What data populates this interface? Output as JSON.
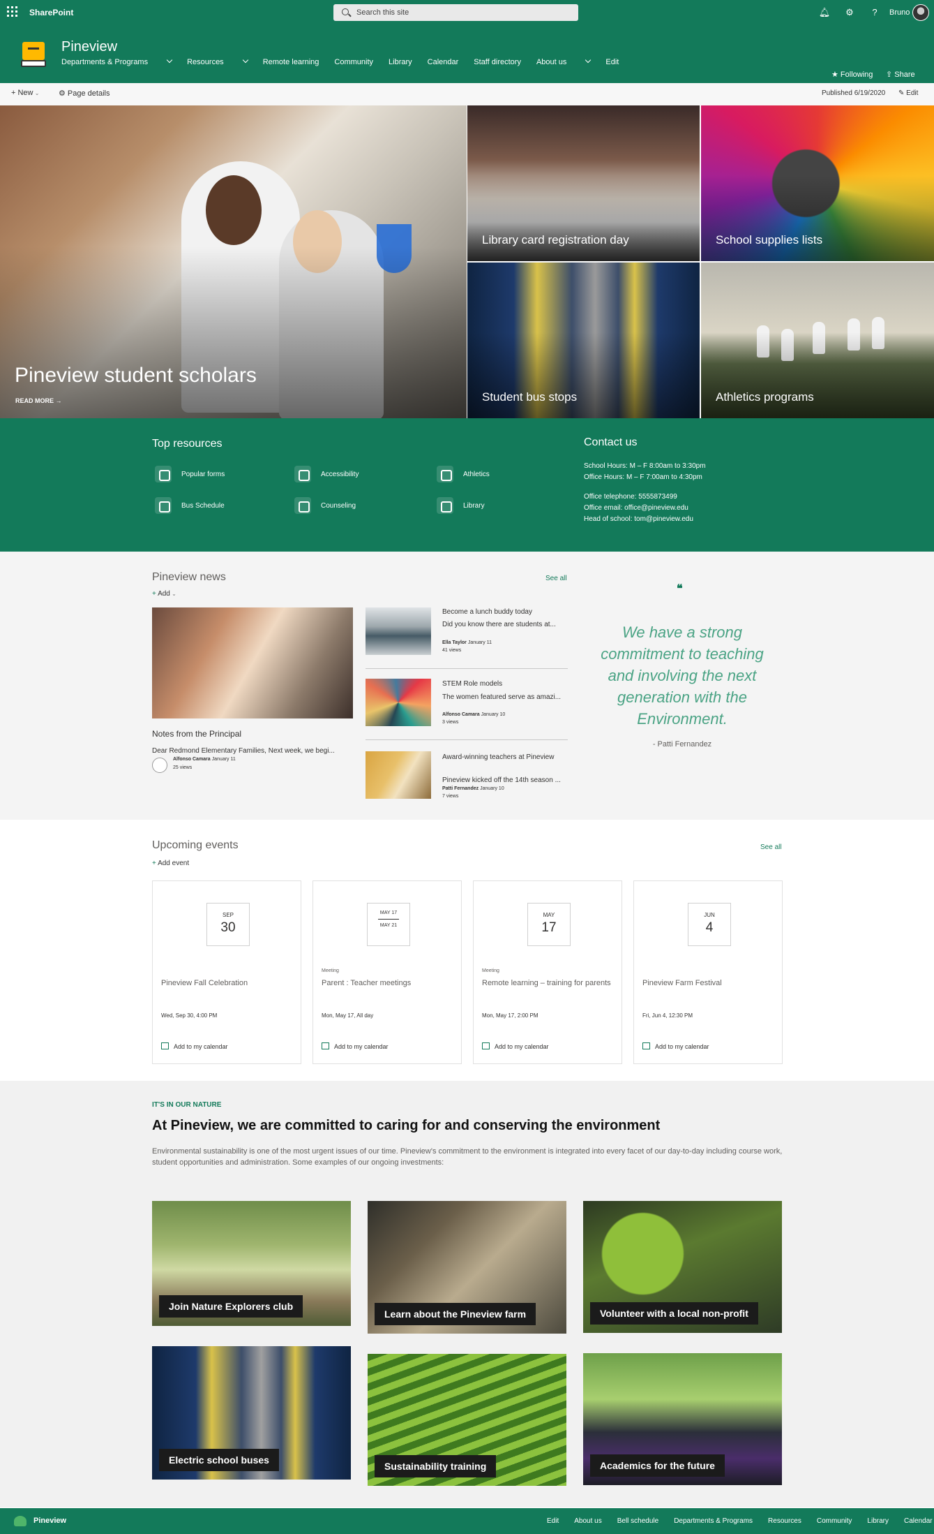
{
  "suite": {
    "brand": "SharePoint",
    "search_placeholder": "Search this site",
    "user": "Bruno",
    "icons": [
      "bell-icon",
      "gear-icon",
      "help-icon"
    ]
  },
  "site": {
    "name": "Pineview",
    "nav": [
      "Departments & Programs",
      "Resources",
      "Remote learning",
      "Community",
      "Library",
      "Calendar",
      "Staff directory",
      "About us",
      "Edit"
    ],
    "following": "Following",
    "share": "Share"
  },
  "command": {
    "new": "New",
    "page_details": "Page details",
    "published": "Published 6/19/2020",
    "edit": "Edit"
  },
  "hero": {
    "main_title": "Pineview student scholars",
    "read_more": "READ MORE",
    "tiles": [
      "Library card registration day",
      "School supplies lists",
      "Student bus stops",
      "Athletics programs"
    ]
  },
  "resources": {
    "title": "Top resources",
    "items": [
      "Popular forms",
      "Accessibility",
      "Athletics",
      "Bus Schedule",
      "Counseling",
      "Library"
    ]
  },
  "contact": {
    "title": "Contact us",
    "lines": [
      "School Hours: M – F 8:00am to 3:30pm",
      "Office Hours: M – F 7:00am to 4:30pm",
      "Office telephone: 5555873499",
      "Office email: office@pineview.edu",
      "Head of school: tom@pineview.edu"
    ]
  },
  "news": {
    "title": "Pineview news",
    "see_all": "See all",
    "add": "Add",
    "main": {
      "title": "Notes from the Principal",
      "desc": "Dear Redmond Elementary Families, Next week, we begi...",
      "author": "Alfonso Camara",
      "date": "January 11",
      "views": "25 views"
    },
    "items": [
      {
        "title": "Become a lunch buddy today",
        "desc": "Did you know there are students at...",
        "author": "Ella Taylor",
        "date": "January 11",
        "views": "41 views"
      },
      {
        "title": "STEM Role models",
        "desc": "The women featured serve as amazi...",
        "author": "Alfonso Camara",
        "date": "January 10",
        "views": "3 views"
      },
      {
        "title": "Award-winning teachers at Pineview",
        "desc": "Pineview kicked off the 14th season ...",
        "author": "Patti Fernandez",
        "date": "January 10",
        "views": "7 views"
      }
    ],
    "quote_mark": "❝",
    "quote": "We have a strong commitment to teaching and involving the next generation with the Environment.",
    "quote_author": "- Patti Fernandez"
  },
  "events": {
    "title": "Upcoming events",
    "see_all": "See all",
    "add": "Add event",
    "add_to_cal": "Add to my calendar",
    "items": [
      {
        "month": "SEP",
        "day": "30",
        "category": "",
        "name": "Pineview Fall Celebration",
        "time": "Wed, Sep 30, 4:00 PM"
      },
      {
        "range_start": "MAY 17",
        "range_end": "MAY 21",
        "category": "Meeting",
        "name": "Parent : Teacher meetings",
        "time": "Mon, May 17, All day"
      },
      {
        "month": "MAY",
        "day": "17",
        "category": "Meeting",
        "name": "Remote learning – training for parents",
        "time": "Mon, May 17, 2:00 PM"
      },
      {
        "month": "JUN",
        "day": "4",
        "category": "",
        "name": "Pineview Farm Festival",
        "time": "Fri, Jun 4, 12:30 PM"
      }
    ]
  },
  "nature": {
    "kicker": "IT'S IN OUR NATURE",
    "heading": "At Pineview, we are committed to caring for and conserving the environment",
    "body": "Environmental sustainability is one of the most urgent issues of our time. Pineview's commitment to the environment is integrated into every facet of our day-to-day including course work, student opportunities and administration. Some examples of our ongoing investments:",
    "tiles": [
      "Join Nature Explorers club",
      "Learn about the Pineview farm",
      "Volunteer with a local non-profit",
      "Electric school buses",
      "Sustainability training",
      "Academics for the future"
    ]
  },
  "footer": {
    "name": "Pineview",
    "nav": [
      "Edit",
      "About us",
      "Bell schedule",
      "Departments & Programs",
      "Resources",
      "Community",
      "Library",
      "Calendar"
    ]
  },
  "colors": {
    "brand_green": "#137a5a",
    "quote_green": "#4aa384"
  }
}
